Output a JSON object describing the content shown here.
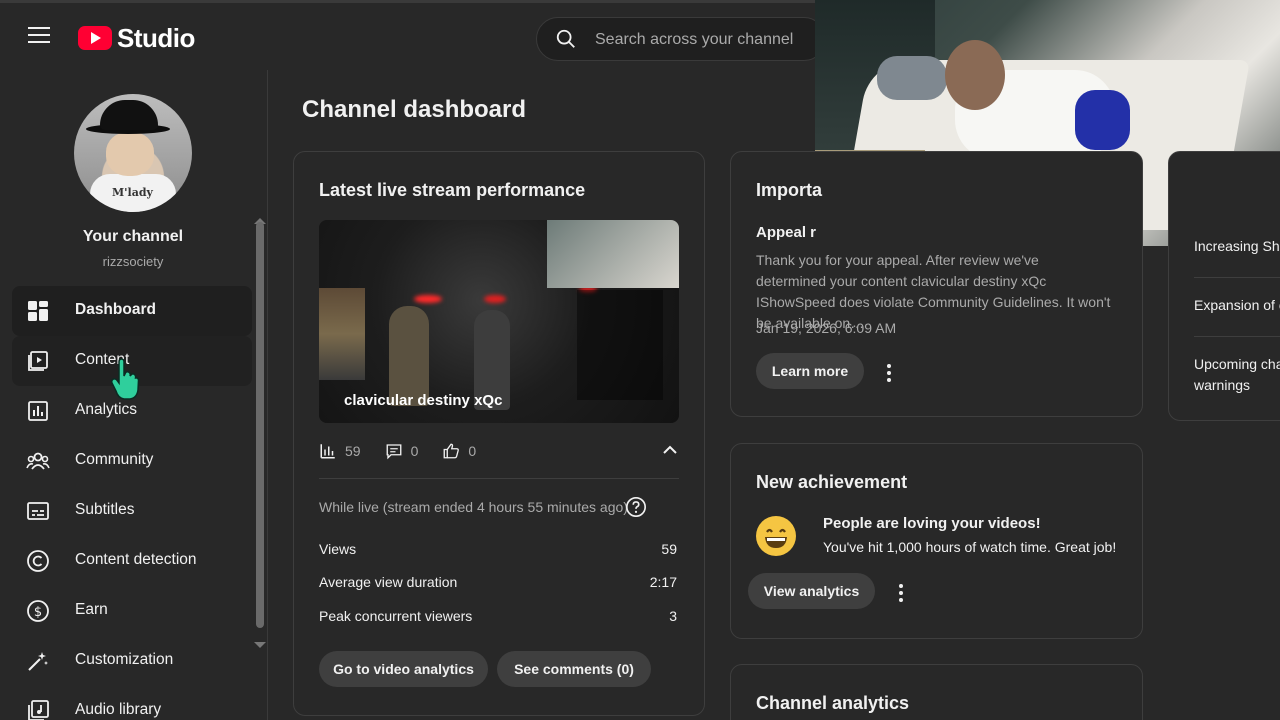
{
  "header": {
    "logo_text": "Studio",
    "search_placeholder": "Search across your channel"
  },
  "sidebar": {
    "channel_name": "Your channel",
    "channel_handle": "rizzsociety",
    "avatar_text": "M'lady",
    "items": [
      {
        "label": "Dashboard",
        "icon": "dashboard-icon"
      },
      {
        "label": "Content",
        "icon": "content-icon"
      },
      {
        "label": "Analytics",
        "icon": "analytics-icon"
      },
      {
        "label": "Community",
        "icon": "community-icon"
      },
      {
        "label": "Subtitles",
        "icon": "subtitles-icon"
      },
      {
        "label": "Content detection",
        "icon": "copyright-icon"
      },
      {
        "label": "Earn",
        "icon": "earn-icon"
      },
      {
        "label": "Customization",
        "icon": "customization-icon"
      },
      {
        "label": "Audio library",
        "icon": "audio-library-icon"
      }
    ]
  },
  "main": {
    "page_title": "Channel dashboard",
    "live_card": {
      "title": "Latest live stream performance",
      "video_title": "clavicular destiny xQc",
      "views_count": "59",
      "comments_count": "0",
      "likes_count": "0",
      "while_live": "While live (stream ended 4 hours 55 minutes ago)",
      "metrics": [
        {
          "label": "Views",
          "value": "59"
        },
        {
          "label": "Average view duration",
          "value": "2:17"
        },
        {
          "label": "Peak concurrent viewers",
          "value": "3"
        }
      ],
      "btn_analytics": "Go to video analytics",
      "btn_comments": "See comments (0)"
    },
    "important_card": {
      "title": "Importa",
      "appeal_title": "Appeal r",
      "appeal_body": "Thank you for your appeal. After review we've determined your content clavicular destiny xQc IShowSpeed does violate Community Guidelines. It won't be available on…",
      "date": "Jan 19, 2026, 6:09 AM",
      "btn_learn": "Learn more"
    },
    "achievement_card": {
      "title": "New achievement",
      "heading": "People are loving your videos!",
      "subtext": "You've hit 1,000 hours of watch time. Great job!",
      "btn_view": "View analytics"
    },
    "analytics_card": {
      "title": "Channel analytics"
    },
    "news_card": {
      "items": [
        "Increasing Sh",
        "Expansion of c",
        "Upcoming cha warnings"
      ]
    }
  },
  "colors": {
    "background": "#282828",
    "brand_red": "#ff0033",
    "text_primary": "#f1f1f1",
    "text_secondary": "#aaaaaa",
    "button_bg": "#3f3f3f"
  }
}
